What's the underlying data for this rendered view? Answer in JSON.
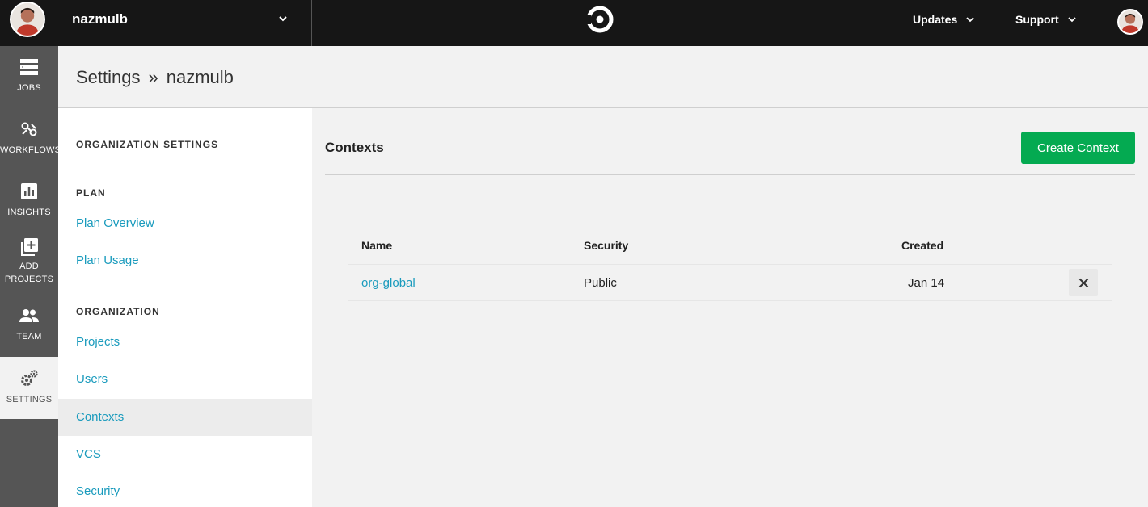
{
  "topbar": {
    "org_name": "nazmulb",
    "menus": {
      "updates": "Updates",
      "support": "Support"
    }
  },
  "leftnav": {
    "items": [
      {
        "label": "JOBS",
        "icon": "jobs-icon"
      },
      {
        "label": "WORKFLOWS",
        "icon": "workflows-icon"
      },
      {
        "label": "INSIGHTS",
        "icon": "insights-icon"
      },
      {
        "label_line1": "ADD",
        "label_line2": "PROJECTS",
        "icon": "add-projects-icon"
      },
      {
        "label": "TEAM",
        "icon": "team-icon"
      },
      {
        "label": "SETTINGS",
        "icon": "settings-icon",
        "active": true
      }
    ]
  },
  "header": {
    "breadcrumb_root": "Settings",
    "separator": "»",
    "breadcrumb_current": "nazmulb"
  },
  "sidebar": {
    "org_settings_heading": "ORGANIZATION SETTINGS",
    "plan_heading": "PLAN",
    "plan_links": [
      "Plan Overview",
      "Plan Usage"
    ],
    "organization_heading": "ORGANIZATION",
    "org_links": [
      "Projects",
      "Users",
      "Contexts",
      "VCS",
      "Security"
    ],
    "active": "Contexts"
  },
  "main": {
    "title": "Contexts",
    "create_button": "Create Context",
    "table": {
      "headers": {
        "name": "Name",
        "security": "Security",
        "created": "Created"
      },
      "rows": [
        {
          "name": "org-global",
          "security": "Public",
          "created": "Jan 14"
        }
      ]
    }
  },
  "colors": {
    "topbar": "#161616",
    "leftnav": "#555555",
    "link": "#1a9bbd",
    "create_button": "#04aa51"
  }
}
